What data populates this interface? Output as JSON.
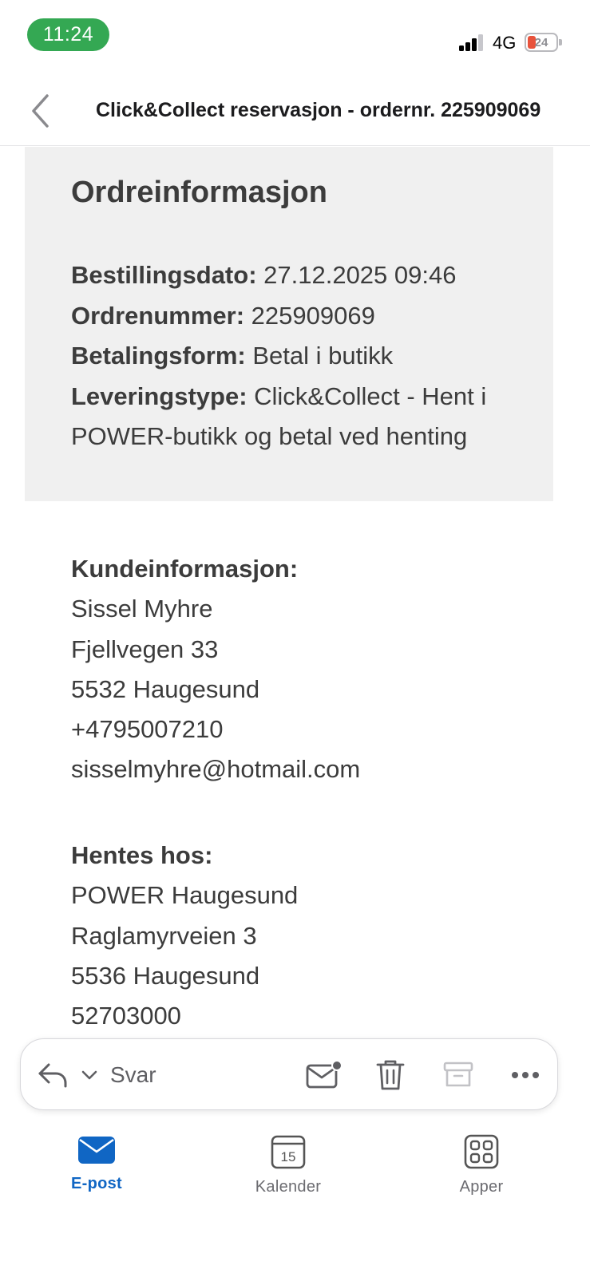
{
  "status_bar": {
    "time": "11:24",
    "network": "4G",
    "battery_level": "24"
  },
  "header": {
    "subject": "Click&Collect reservasjon - ordernr. 225909069"
  },
  "order_info": {
    "title": "Ordreinformasjon",
    "fields": [
      {
        "label": "Bestillingsdato:",
        "value": "27.12.2025 09:46"
      },
      {
        "label": "Ordrenummer:",
        "value": "225909069"
      },
      {
        "label": "Betalingsform:",
        "value": "Betal i butikk"
      },
      {
        "label": "Leveringstype:",
        "value": "Click&Collect - Hent i"
      }
    ],
    "continuation": "POWER-butikk og betal ved henting"
  },
  "customer": {
    "heading": "Kundeinformasjon:",
    "lines": [
      "Sissel Myhre",
      "Fjellvegen 33",
      "5532 Haugesund",
      "+4795007210",
      "sisselmyhre@hotmail.com"
    ]
  },
  "pickup": {
    "heading": "Hentes hos:",
    "lines": [
      "POWER Haugesund",
      "Raglamyrveien 3",
      "5536 Haugesund",
      "52703000"
    ]
  },
  "action_bar": {
    "reply_label": "Svar"
  },
  "tab_bar": {
    "tabs": [
      {
        "label": "E-post",
        "icon": "mail-icon"
      },
      {
        "label": "Kalender",
        "icon": "calendar-icon",
        "day": "15"
      },
      {
        "label": "Apper",
        "icon": "apps-icon"
      }
    ]
  },
  "colors": {
    "status_pill": "#34a853",
    "accent": "#1066c4",
    "box_bg": "#f0f0f0",
    "text": "#3c3c3c"
  }
}
